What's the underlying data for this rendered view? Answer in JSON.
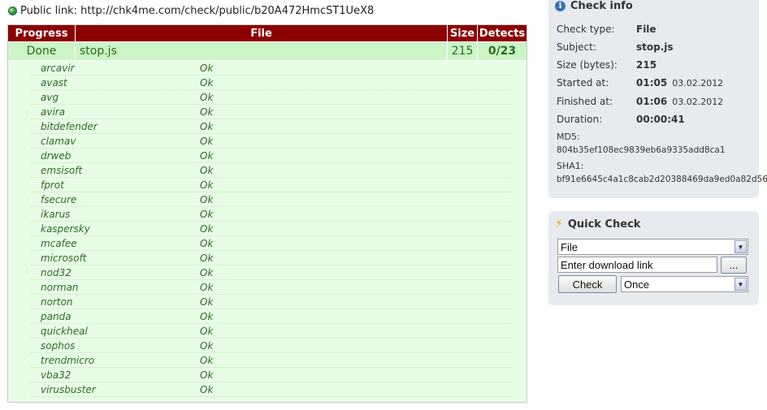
{
  "public_link": {
    "label": "Public link:",
    "url": "http://chk4me.com/check/public/b20A472HmcST1UeX8"
  },
  "results": {
    "columns": {
      "progress": "Progress",
      "file": "File",
      "size": "Size",
      "detects": "Detects"
    },
    "row": {
      "progress": "Done",
      "file": "stop.js",
      "size": "215",
      "detects": "0/23"
    },
    "engines": [
      {
        "name": "arcavir",
        "status": "Ok"
      },
      {
        "name": "avast",
        "status": "Ok"
      },
      {
        "name": "avg",
        "status": "Ok"
      },
      {
        "name": "avira",
        "status": "Ok"
      },
      {
        "name": "bitdefender",
        "status": "Ok"
      },
      {
        "name": "clamav",
        "status": "Ok"
      },
      {
        "name": "drweb",
        "status": "Ok"
      },
      {
        "name": "emsisoft",
        "status": "Ok"
      },
      {
        "name": "fprot",
        "status": "Ok"
      },
      {
        "name": "fsecure",
        "status": "Ok"
      },
      {
        "name": "ikarus",
        "status": "Ok"
      },
      {
        "name": "kaspersky",
        "status": "Ok"
      },
      {
        "name": "mcafee",
        "status": "Ok"
      },
      {
        "name": "microsoft",
        "status": "Ok"
      },
      {
        "name": "nod32",
        "status": "Ok"
      },
      {
        "name": "norman",
        "status": "Ok"
      },
      {
        "name": "norton",
        "status": "Ok"
      },
      {
        "name": "panda",
        "status": "Ok"
      },
      {
        "name": "quickheal",
        "status": "Ok"
      },
      {
        "name": "sophos",
        "status": "Ok"
      },
      {
        "name": "trendmicro",
        "status": "Ok"
      },
      {
        "name": "vba32",
        "status": "Ok"
      },
      {
        "name": "virusbuster",
        "status": "Ok"
      }
    ]
  },
  "check_info": {
    "title": "Check info",
    "icon": "info-icon",
    "check_type_label": "Check type:",
    "check_type": "File",
    "subject_label": "Subject:",
    "subject": "stop.js",
    "size_label": "Size (bytes):",
    "size": "215",
    "started_label": "Started at:",
    "started_time": "01:05",
    "started_date": "03.02.2012",
    "finished_label": "Finished at:",
    "finished_time": "01:06",
    "finished_date": "03.02.2012",
    "duration_label": "Duration:",
    "duration": "00:00:41",
    "md5_label": "MD5:",
    "md5": "804b35ef108ec9839eb6a9335add8ca1",
    "sha1_label": "SHA1:",
    "sha1": "bf91e6645c4a1c8cab2d20388469da9ed0a82d56"
  },
  "quick_check": {
    "title": "Quick Check",
    "icon": "lightning-icon",
    "type_select": "File",
    "link_placeholder": "Enter download link",
    "browse_label": "...",
    "check_label": "Check",
    "frequency_select": "Once"
  },
  "colors": {
    "header_bg": "#8b0000",
    "row_bg": "#ccf5c7",
    "engines_bg": "#e8fde6",
    "text_green": "#2e6a27",
    "panel_bg": "#e7ebf0"
  }
}
